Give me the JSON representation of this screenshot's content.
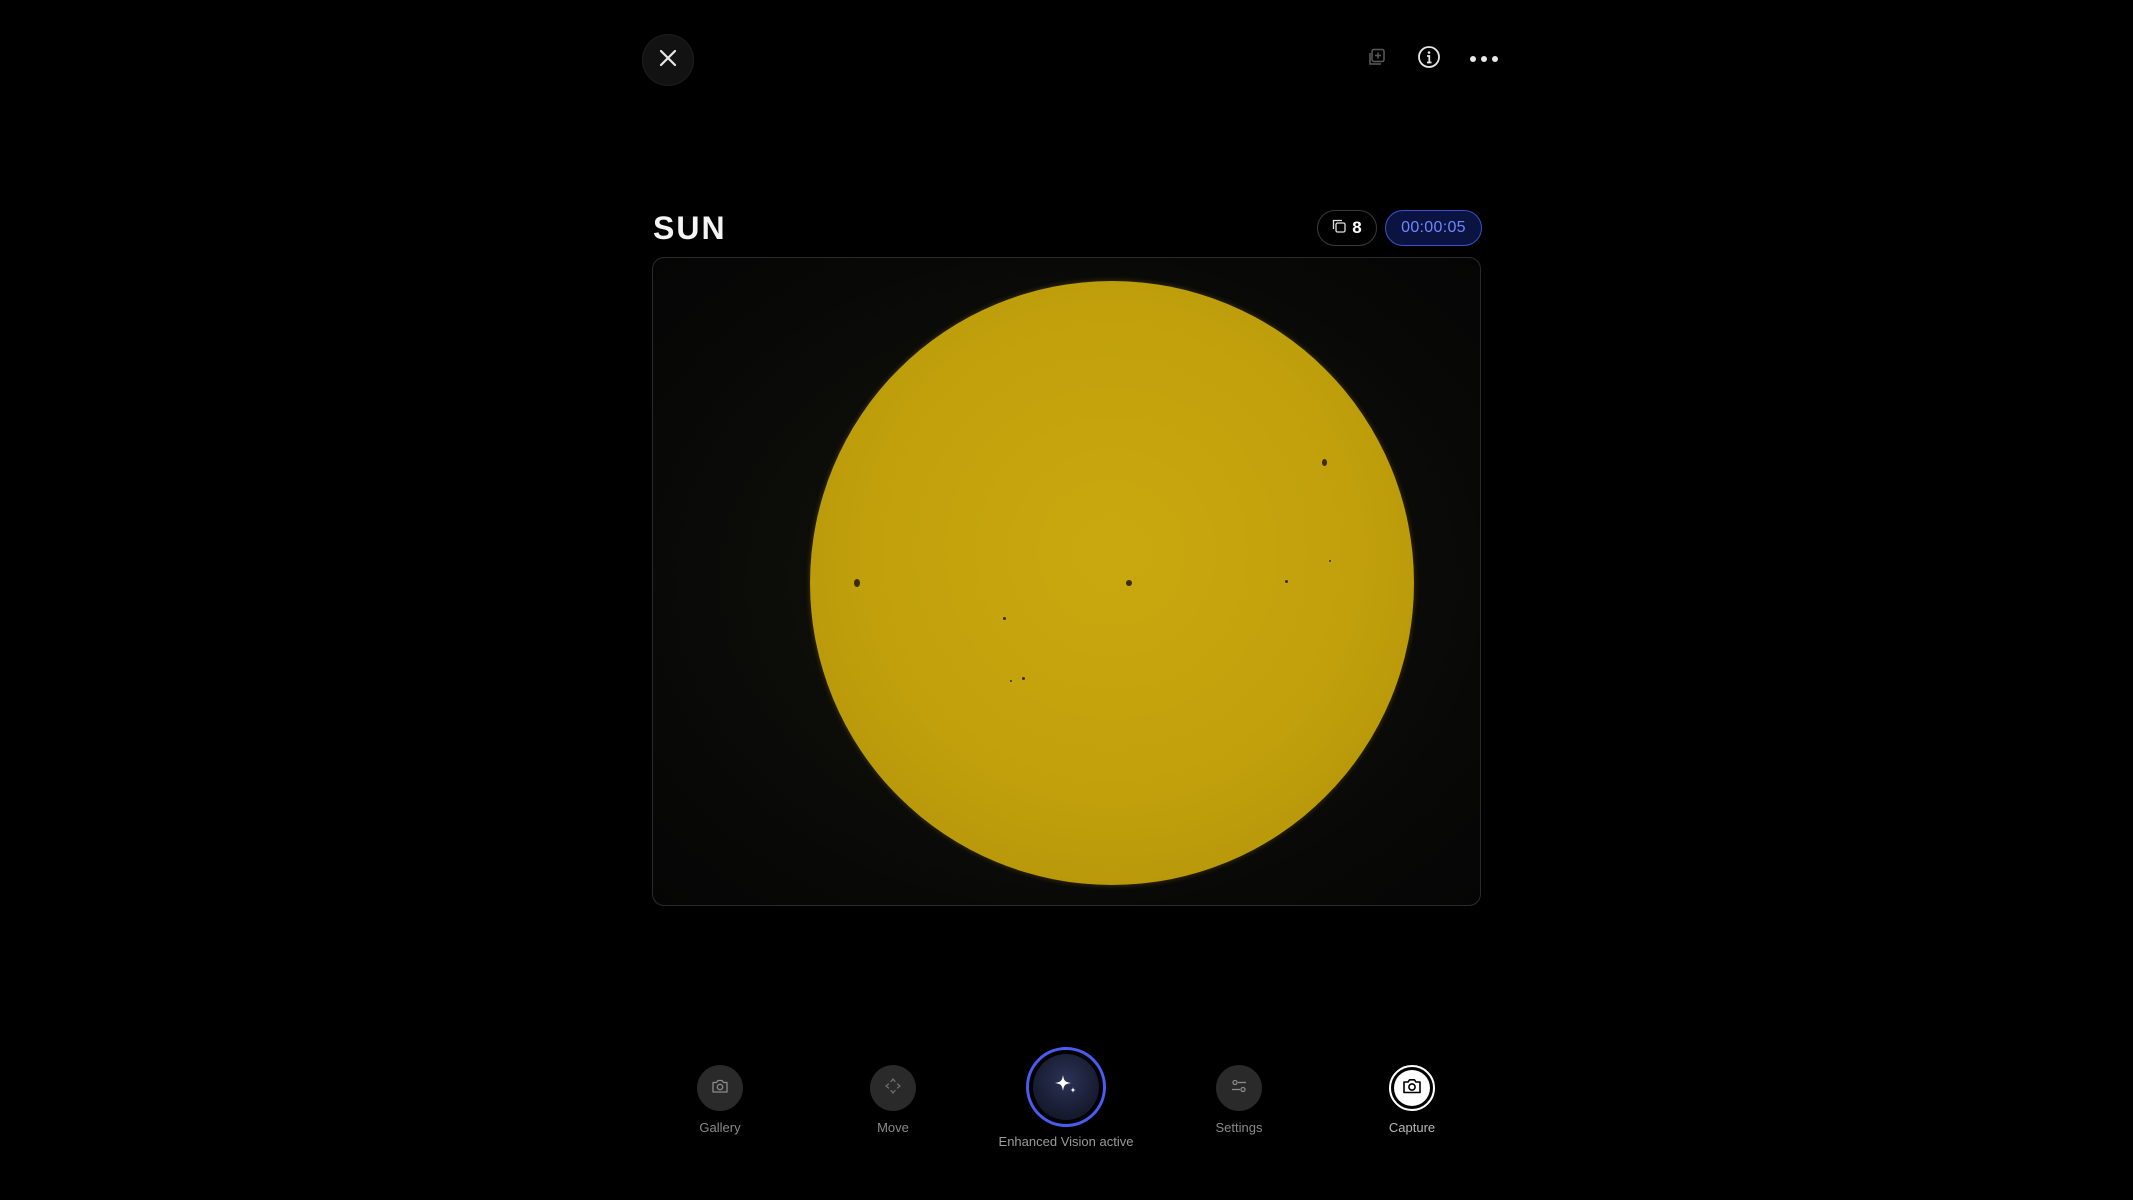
{
  "header": {
    "close_icon": "close-icon",
    "add_icon": "add-to-stack-icon",
    "info_icon": "info-icon",
    "more_icon": "more-icon"
  },
  "target": {
    "title": "SUN",
    "stack_count": "8",
    "stack_icon": "stack-icon",
    "timer": "00:00:05"
  },
  "controls": {
    "gallery": {
      "label": "Gallery",
      "icon": "camera-icon"
    },
    "move": {
      "label": "Move",
      "icon": "move-icon"
    },
    "enhanced": {
      "label": "Enhanced Vision active",
      "icon": "sparkle-icon"
    },
    "settings": {
      "label": "Settings",
      "icon": "sliders-icon"
    },
    "capture": {
      "label": "Capture",
      "icon": "camera-icon"
    }
  },
  "colors": {
    "background": "#000000",
    "accent": "#4a5cf0",
    "timer_text": "#6f86ff",
    "sun": "#c1a00c"
  }
}
